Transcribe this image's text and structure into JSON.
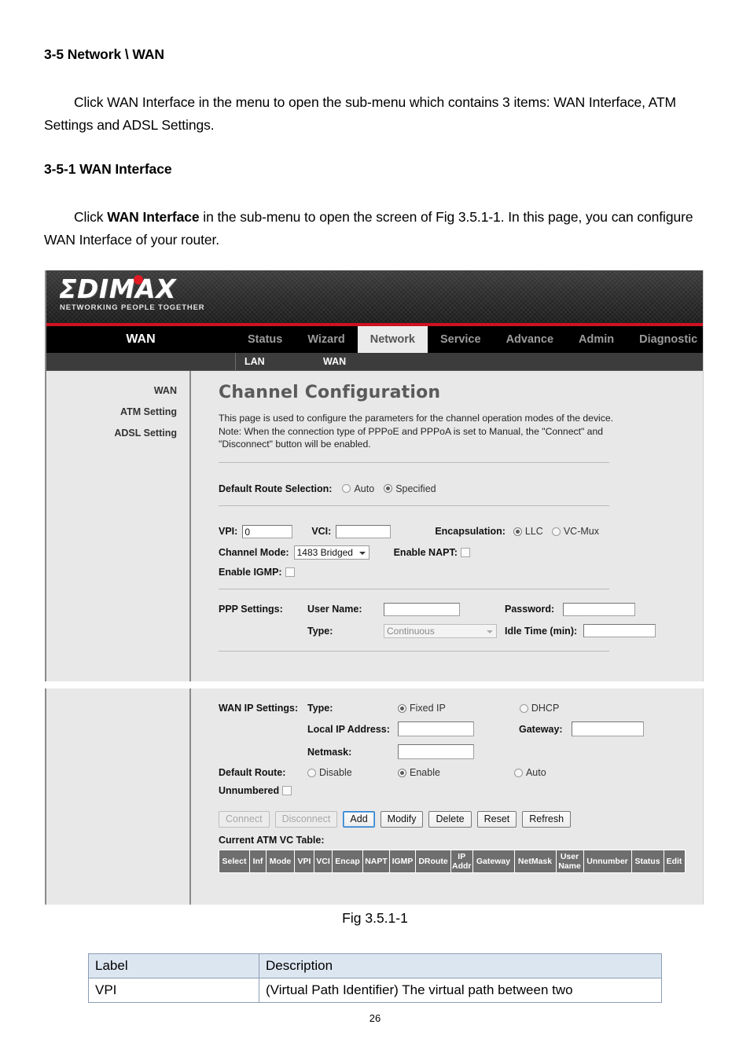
{
  "document": {
    "heading1": "3-5 Network \\ WAN",
    "para1_indent": "Click WAN Interface in the menu to open the sub-menu which contains 3 items: WAN Interface, ATM Settings and ADSL Settings.",
    "heading2": "3-5-1 WAN Interface",
    "para2_a": "Click ",
    "para2_bold": "WAN Interface",
    "para2_b": " in the sub-menu to open the screen of Fig 3.5.1-1. In this page, you can configure WAN Interface of your router.",
    "figure_caption": "Fig 3.5.1-1",
    "page_number": "26"
  },
  "label_table": {
    "headers": [
      "Label",
      "Description"
    ],
    "rows": [
      [
        "VPI",
        "(Virtual Path Identifier) The virtual path between two"
      ]
    ],
    "header_bg": "#dce6f1"
  },
  "router_ui": {
    "brand": {
      "logo_text": "ΣDIMAX",
      "tagline": "NETWORKING PEOPLE TOGETHER",
      "accent_color": "#cf1122",
      "dot_color": "#e01b24"
    },
    "nav": {
      "section_label": "WAN",
      "items": [
        {
          "label": "Status",
          "active": false
        },
        {
          "label": "Wizard",
          "active": false
        },
        {
          "label": "Network",
          "active": true
        },
        {
          "label": "Service",
          "active": false
        },
        {
          "label": "Advance",
          "active": false
        },
        {
          "label": "Admin",
          "active": false
        },
        {
          "label": "Diagnostic",
          "active": false
        }
      ]
    },
    "subnav": {
      "items": [
        {
          "label": "LAN"
        },
        {
          "label": "WAN"
        }
      ]
    },
    "sidebar": {
      "items": [
        {
          "label": "WAN"
        },
        {
          "label": "ATM Setting"
        },
        {
          "label": "ADSL Setting"
        }
      ]
    },
    "panel": {
      "title": "Channel Configuration",
      "description_line1": "This page is used to configure the parameters for the channel operation modes of the device.",
      "description_line2": "Note: When the connection type of PPPoE and PPPoA is set to Manual, the \"Connect\" and",
      "description_line3": "\"Disconnect\" button will be enabled."
    },
    "default_route_selection": {
      "label": "Default Route Selection:",
      "options": [
        {
          "label": "Auto",
          "selected": false
        },
        {
          "label": "Specified",
          "selected": true
        }
      ]
    },
    "atm": {
      "vpi_label": "VPI:",
      "vpi_value": "0",
      "vci_label": "VCI:",
      "vci_value": "",
      "encapsulation_label": "Encapsulation:",
      "encapsulation_options": [
        {
          "label": "LLC",
          "selected": true
        },
        {
          "label": "VC-Mux",
          "selected": false
        }
      ],
      "channel_mode_label": "Channel Mode:",
      "channel_mode_value": "1483 Bridged",
      "enable_napt_label": "Enable NAPT:",
      "enable_napt_checked": false,
      "enable_igmp_label": "Enable IGMP:",
      "enable_igmp_checked": false
    },
    "ppp": {
      "section_label": "PPP Settings:",
      "username_label": "User Name:",
      "username_value": "",
      "password_label": "Password:",
      "password_value": "",
      "type_label": "Type:",
      "type_value": "Continuous",
      "type_disabled": true,
      "idle_time_label": "Idle Time (min):",
      "idle_time_value": ""
    },
    "wan_ip": {
      "section_label": "WAN IP Settings:",
      "type_label": "Type:",
      "type_options": [
        {
          "label": "Fixed IP",
          "selected": true
        },
        {
          "label": "DHCP",
          "selected": false
        }
      ],
      "local_ip_label": "Local IP Address:",
      "local_ip_value": "",
      "gateway_label": "Gateway:",
      "gateway_value": "",
      "netmask_label": "Netmask:",
      "netmask_value": "",
      "default_route_label": "Default Route:",
      "default_route_options": [
        {
          "label": "Disable",
          "selected": false
        },
        {
          "label": "Enable",
          "selected": true
        },
        {
          "label": "Auto",
          "selected": false
        }
      ],
      "unnumbered_label": "Unnumbered",
      "unnumbered_checked": false
    },
    "buttons": [
      {
        "label": "Connect",
        "disabled": true,
        "focused": false
      },
      {
        "label": "Disconnect",
        "disabled": true,
        "focused": false
      },
      {
        "label": "Add",
        "disabled": false,
        "focused": true
      },
      {
        "label": "Modify",
        "disabled": false,
        "focused": false
      },
      {
        "label": "Delete",
        "disabled": false,
        "focused": false
      },
      {
        "label": "Reset",
        "disabled": false,
        "focused": false
      },
      {
        "label": "Refresh",
        "disabled": false,
        "focused": false
      }
    ],
    "vc_table": {
      "caption": "Current ATM VC Table:",
      "headers": [
        "Select",
        "Inf",
        "Mode",
        "VPI",
        "VCI",
        "Encap",
        "NAPT",
        "IGMP",
        "DRoute",
        "IP Addr",
        "Gateway",
        "NetMask",
        "User Name",
        "Unnumber",
        "Status",
        "Edit"
      ],
      "header_bg": "#6e6e6e",
      "rows": []
    }
  }
}
